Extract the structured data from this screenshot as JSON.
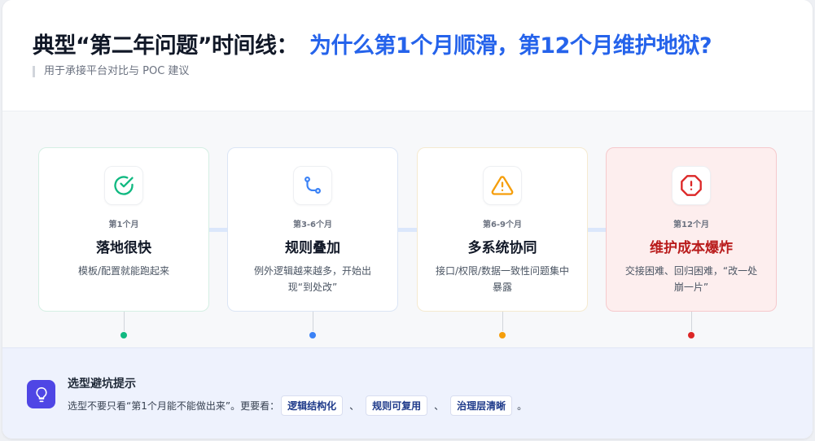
{
  "header": {
    "title_part1": "典型“第二年问题”时间线：",
    "title_part2": "为什么第1个月顺滑，第12个月维护地狱?",
    "subtitle": "用于承接平台对比与 POC 建议"
  },
  "colors": {
    "accent_blue": "#2563eb",
    "green": "#10b981",
    "blue": "#3b82f6",
    "amber": "#f59e0b",
    "red": "#dc2626",
    "indigo": "#4f46e5"
  },
  "stages": [
    {
      "period": "第1个月",
      "title": "落地很快",
      "desc": "模板/配置就能跑起来",
      "icon": "check-circle-icon"
    },
    {
      "period": "第3-6个月",
      "title": "规则叠加",
      "desc": "例外逻辑越来越多，开始出现“到处改”",
      "icon": "branch-icon"
    },
    {
      "period": "第6-9个月",
      "title": "多系统协同",
      "desc": "接口/权限/数据一致性问题集中暴露",
      "icon": "warning-triangle-icon"
    },
    {
      "period": "第12个月",
      "title": "维护成本爆炸",
      "desc": "交接困难、回归困难，“改一处崩一片”",
      "icon": "alert-octagon-icon"
    }
  ],
  "tip": {
    "icon": "lightbulb-icon",
    "title": "选型避坑提示",
    "text_prefix": "选型不要只看“第1个月能不能做出来”。更要看：",
    "chips": [
      "逻辑结构化",
      "规则可复用",
      "治理层清晰"
    ],
    "separator": "、",
    "end": "。"
  }
}
